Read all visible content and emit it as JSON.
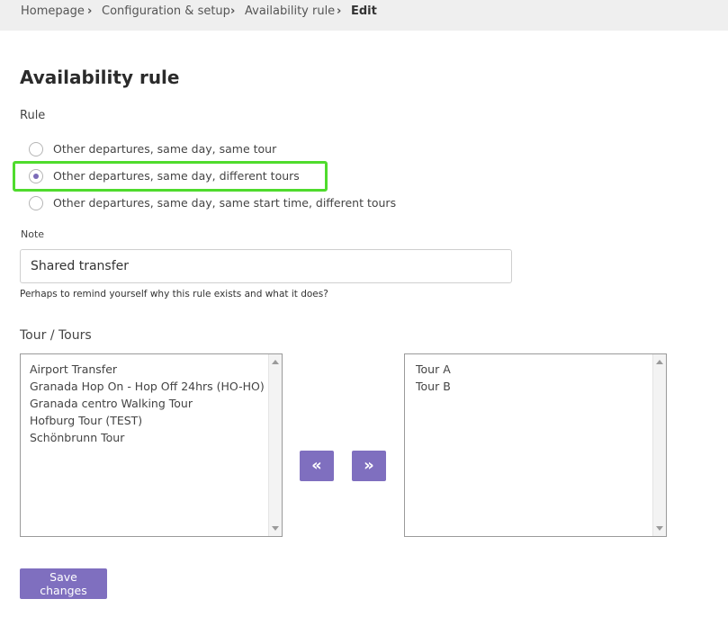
{
  "breadcrumb": {
    "items": [
      "Homepage",
      "Configuration & setup",
      "Availability rule"
    ],
    "current": "Edit"
  },
  "page": {
    "title": "Availability rule"
  },
  "rule": {
    "label": "Rule",
    "options": [
      {
        "label": "Other departures, same day, same tour",
        "checked": false
      },
      {
        "label": "Other departures, same day, different tours",
        "checked": true
      },
      {
        "label": "Other departures, same day, same start time, different tours",
        "checked": false
      }
    ]
  },
  "note": {
    "label": "Note",
    "value": "Shared transfer",
    "help": "Perhaps to remind yourself why this rule exists and what it does?"
  },
  "tours": {
    "label": "Tour / Tours",
    "available": [
      "Airport Transfer",
      "Granada Hop On - Hop Off 24hrs (HO-HO)",
      "Granada centro Walking Tour",
      "Hofburg Tour (TEST)",
      "Schönbrunn Tour"
    ],
    "selected": [
      "Tour A",
      "Tour B"
    ],
    "move_left_glyph": "«",
    "move_right_glyph": "»"
  },
  "actions": {
    "save_label": "Save changes"
  },
  "colors": {
    "accent": "#7f6fbf",
    "highlight": "#4fdb2d",
    "breadcrumb_bg": "#efefef"
  }
}
